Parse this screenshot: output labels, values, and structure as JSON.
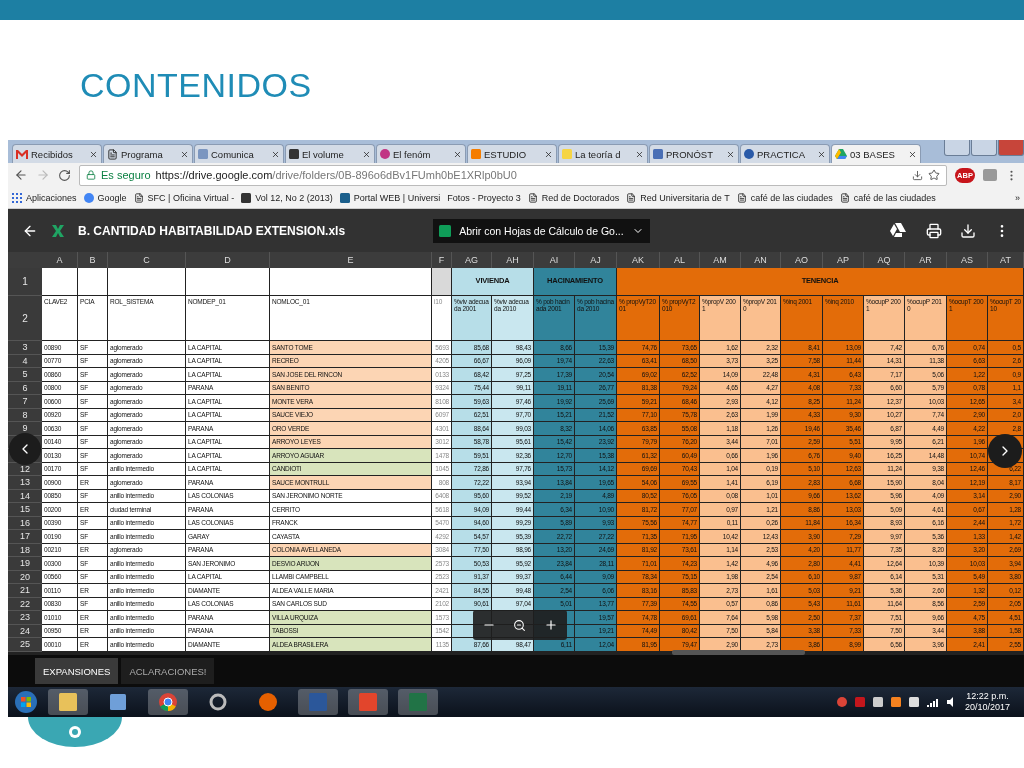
{
  "slide": {
    "title": "CONTENIDOS"
  },
  "browser": {
    "tabs": [
      {
        "label": "Recibidos",
        "selected": false
      },
      {
        "label": "Programa",
        "selected": false
      },
      {
        "label": "Comunica",
        "selected": false
      },
      {
        "label": "El volume",
        "selected": false
      },
      {
        "label": "El fenóm",
        "selected": false
      },
      {
        "label": "ESTUDIO",
        "selected": false
      },
      {
        "label": "La teoría d",
        "selected": false
      },
      {
        "label": "PRONÓST",
        "selected": false
      },
      {
        "label": "PRACTICA",
        "selected": false
      },
      {
        "label": "03 BASES",
        "selected": true
      }
    ],
    "secure_label": "Es seguro",
    "url_host": "https://drive.google.com",
    "url_path": "/drive/folders/0B-896o6dBv1FUmh0bE1XRlp0bU0",
    "extension_badge": "ABP",
    "bookmarks": [
      "Aplicaciones",
      "Google",
      "SFC | Oficina Virtual -",
      "Vol 12, No 2 (2013)",
      "Portal WEB | Universi",
      "Fotos - Proyecto 3",
      "Red de Doctorados",
      "Red Universitaria de T",
      "café de las ciudades",
      "café de las ciudades"
    ],
    "bookmarks_more": "»"
  },
  "viewer": {
    "file_name": "B. CANTIDAD HABITABILIDAD EXTENSION.xls",
    "open_with": "Abrir con Hojas de Cálculo de Go..."
  },
  "sheet": {
    "header_row_numbers": [
      "1",
      "2"
    ],
    "plain_columns": [
      {
        "letter": "A",
        "heading": "CLAVE2"
      },
      {
        "letter": "B",
        "heading": "PCIA"
      },
      {
        "letter": "C",
        "heading": "ROL_SISTEMA"
      },
      {
        "letter": "D",
        "heading": "NOMDEP_01"
      },
      {
        "letter": "E",
        "heading": "NOMLOC_01"
      },
      {
        "letter": "F",
        "heading": "i10"
      }
    ],
    "groups": [
      {
        "label": "VIVIENDA",
        "color": "#b7dee8",
        "columns": [
          {
            "letter": "AG",
            "heading": "%viv adecuada 2001",
            "color": "#b7dee8"
          },
          {
            "letter": "AH",
            "heading": "%viv adecuada 2010",
            "color": "#c9e7ef"
          }
        ]
      },
      {
        "label": "HACINAMIENTO",
        "color": "#31849b",
        "columns": [
          {
            "letter": "AI",
            "heading": "% pob hacinada 2001",
            "color": "#31849b"
          },
          {
            "letter": "AJ",
            "heading": "% pob hacinada 2010",
            "color": "#31849b"
          }
        ]
      },
      {
        "label": "TENENCIA",
        "color": "#e36c09",
        "columns": [
          {
            "letter": "AK",
            "heading": "% propVyT2001",
            "color": "#e36c09"
          },
          {
            "letter": "AL",
            "heading": "% propVyT2010",
            "color": "#e36c09"
          },
          {
            "letter": "AM",
            "heading": "%propV 2001",
            "color": "#fabf8f"
          },
          {
            "letter": "AN",
            "heading": "%propV 2010",
            "color": "#fabf8f"
          },
          {
            "letter": "AO",
            "heading": "%inq 2001",
            "color": "#e36c09"
          },
          {
            "letter": "AP",
            "heading": "%inq 2010",
            "color": "#e36c09"
          },
          {
            "letter": "AQ",
            "heading": "%ocupP 2001",
            "color": "#fabf8f"
          },
          {
            "letter": "AR",
            "heading": "%ocupP 2010",
            "color": "#fabf8f"
          },
          {
            "letter": "AS",
            "heading": "%ocupT 2001",
            "color": "#e36c09"
          },
          {
            "letter": "AT",
            "heading": "%ocupT 2010",
            "color": "#e36c09"
          }
        ]
      }
    ],
    "rows": [
      {
        "number": "3",
        "cells": [
          "00890",
          "SF",
          "aglomerado",
          "LA CAPITAL",
          "SANTO TOME",
          "5693"
        ],
        "color": "#fcd5b4",
        "values": [
          "85,68",
          "98,43",
          "8,66",
          "15,39",
          "74,76",
          "73,65",
          "1,62",
          "2,32",
          "8,41",
          "13,09",
          "7,42",
          "6,76",
          "0,74",
          "0,5"
        ]
      },
      {
        "number": "4",
        "cells": [
          "00770",
          "SF",
          "aglomerado",
          "LA CAPITAL",
          "RECREO",
          "4205"
        ],
        "color": "#fcd5b4",
        "values": [
          "66,67",
          "96,09",
          "19,74",
          "22,63",
          "63,41",
          "68,50",
          "3,73",
          "3,25",
          "7,58",
          "11,44",
          "14,31",
          "11,38",
          "6,63",
          "2,6"
        ]
      },
      {
        "number": "5",
        "cells": [
          "00860",
          "SF",
          "aglomerado",
          "LA CAPITAL",
          "SAN JOSE DEL RINCON",
          "0133"
        ],
        "color": "#fcd5b4",
        "values": [
          "68,42",
          "97,25",
          "17,39",
          "20,54",
          "69,02",
          "62,52",
          "14,09",
          "22,48",
          "4,31",
          "6,43",
          "7,17",
          "5,06",
          "1,22",
          "0,9"
        ]
      },
      {
        "number": "6",
        "cells": [
          "00800",
          "SF",
          "aglomerado",
          "PARANA",
          "SAN BENITO",
          "9324"
        ],
        "color": "#fcd5b4",
        "values": [
          "75,44",
          "99,11",
          "19,11",
          "26,77",
          "81,38",
          "79,24",
          "4,65",
          "4,27",
          "4,08",
          "7,33",
          "6,60",
          "5,79",
          "0,78",
          "1,1"
        ]
      },
      {
        "number": "7",
        "cells": [
          "00600",
          "SF",
          "aglomerado",
          "LA CAPITAL",
          "MONTE VERA",
          "8108"
        ],
        "color": "#fcd5b4",
        "values": [
          "59,63",
          "97,46",
          "19,92",
          "25,69",
          "59,21",
          "68,46",
          "2,93",
          "4,12",
          "8,25",
          "11,24",
          "12,37",
          "10,03",
          "12,65",
          "3,4"
        ]
      },
      {
        "number": "8",
        "cells": [
          "00920",
          "SF",
          "aglomerado",
          "LA CAPITAL",
          "SAUCE VIEJO",
          "6097"
        ],
        "color": "#fcd5b4",
        "values": [
          "62,51",
          "97,70",
          "15,21",
          "21,52",
          "77,10",
          "75,78",
          "2,63",
          "1,99",
          "4,33",
          "9,30",
          "10,27",
          "7,74",
          "2,90",
          "2,0"
        ]
      },
      {
        "number": "9",
        "cells": [
          "00630",
          "SF",
          "aglomerado",
          "PARANA",
          "ORO VERDE",
          "4301"
        ],
        "color": "#fcd5b4",
        "values": [
          "88,64",
          "99,03",
          "8,32",
          "14,06",
          "63,85",
          "55,08",
          "1,18",
          "1,26",
          "19,46",
          "35,46",
          "6,87",
          "4,49",
          "4,22",
          "2,8"
        ]
      },
      {
        "cells": [
          "00140",
          "SF",
          "aglomerado",
          "LA CAPITAL",
          "ARROYO LEYES",
          "3012"
        ],
        "color": "#fcd5b4",
        "covered": false,
        "values": [
          "58,78",
          "95,61",
          "15,42",
          "23,92",
          "79,79",
          "76,20",
          "3,44",
          "7,01",
          "2,59",
          "5,51",
          "9,95",
          "6,21",
          "1,96"
        ]
      },
      {
        "cells": [
          "00130",
          "SF",
          "aglomerado",
          "LA CAPITAL",
          "ARROYO AGUIAR",
          "1478"
        ],
        "color": "#d8e4bc",
        "covered": false,
        "values": [
          "59,51",
          "92,36",
          "12,70",
          "15,38",
          "61,32",
          "60,49",
          "0,66",
          "1,96",
          "6,76",
          "9,40",
          "16,25",
          "14,48",
          "10,74"
        ]
      },
      {
        "number": "12",
        "cells": [
          "00170",
          "SF",
          "anillo intermedio",
          "LA CAPITAL",
          "CANDIOTI",
          "1045"
        ],
        "color": "#d8e4bc",
        "values": [
          "72,86",
          "97,76",
          "15,73",
          "14,12",
          "69,69",
          "70,43",
          "1,04",
          "0,19",
          "5,10",
          "12,63",
          "11,24",
          "9,38",
          "12,46",
          "6,22"
        ]
      },
      {
        "number": "13",
        "cells": [
          "00900",
          "ER",
          "aglomerado",
          "PARANA",
          "SAUCE MONTRULL",
          "808"
        ],
        "color": "#fcd5b4",
        "values": [
          "72,22",
          "93,94",
          "13,84",
          "19,65",
          "54,06",
          "69,55",
          "1,41",
          "6,19",
          "2,83",
          "6,68",
          "15,90",
          "8,04",
          "12,19",
          "8,17"
        ]
      },
      {
        "number": "14",
        "cells": [
          "00850",
          "SF",
          "anillo intermedio",
          "LAS COLONIAS",
          "SAN JERONIMO NORTE",
          "6408"
        ],
        "color": "#ffffff",
        "values": [
          "95,60",
          "99,52",
          "2,19",
          "4,89",
          "80,52",
          "76,05",
          "0,08",
          "1,01",
          "9,66",
          "13,62",
          "5,96",
          "4,09",
          "3,14",
          "2,90"
        ]
      },
      {
        "number": "15",
        "cells": [
          "00200",
          "ER",
          "ciudad terminal",
          "PARANA",
          "CERRITO",
          "5618"
        ],
        "color": "#ffffff",
        "values": [
          "94,09",
          "99,44",
          "6,34",
          "10,90",
          "81,72",
          "77,07",
          "0,97",
          "1,21",
          "8,86",
          "13,03",
          "5,09",
          "4,61",
          "0,67",
          "1,28"
        ]
      },
      {
        "number": "16",
        "cells": [
          "00390",
          "SF",
          "anillo intermedio",
          "LAS COLONIAS",
          "FRANCK",
          "5470"
        ],
        "color": "#ffffff",
        "values": [
          "94,60",
          "99,29",
          "5,89",
          "9,93",
          "75,56",
          "74,77",
          "0,11",
          "0,26",
          "11,84",
          "16,34",
          "8,93",
          "6,16",
          "2,44",
          "1,72"
        ]
      },
      {
        "number": "17",
        "cells": [
          "00190",
          "SF",
          "anillo intermedio",
          "GARAY",
          "CAYASTA",
          "4292"
        ],
        "color": "#ffffff",
        "values": [
          "54,57",
          "95,39",
          "22,72",
          "27,22",
          "71,35",
          "71,95",
          "10,42",
          "12,43",
          "3,90",
          "7,29",
          "9,97",
          "5,36",
          "1,33",
          "1,42"
        ]
      },
      {
        "number": "18",
        "cells": [
          "00210",
          "ER",
          "aglomerado",
          "PARANA",
          "COLONIA AVELLANEDA",
          "3084"
        ],
        "color": "#fcd5b4",
        "values": [
          "77,50",
          "98,96",
          "13,20",
          "24,69",
          "81,92",
          "73,61",
          "1,14",
          "2,53",
          "4,20",
          "11,77",
          "7,35",
          "8,20",
          "3,20",
          "2,69"
        ]
      },
      {
        "number": "19",
        "cells": [
          "00300",
          "SF",
          "anillo intermedio",
          "SAN JERONIMO",
          "DESVIO ARIJON",
          "2573"
        ],
        "color": "#d8e4bc",
        "values": [
          "50,53",
          "95,92",
          "23,84",
          "28,11",
          "71,01",
          "74,23",
          "1,42",
          "4,96",
          "2,80",
          "4,41",
          "12,64",
          "10,39",
          "10,03",
          "3,94"
        ]
      },
      {
        "number": "20",
        "cells": [
          "00560",
          "SF",
          "anillo intermedio",
          "LA CAPITAL",
          "LLAMBI CAMPBELL",
          "2523"
        ],
        "color": "#ffffff",
        "values": [
          "91,37",
          "99,37",
          "6,44",
          "9,09",
          "78,34",
          "75,15",
          "1,98",
          "2,54",
          "6,10",
          "9,87",
          "6,14",
          "5,31",
          "5,49",
          "3,80"
        ]
      },
      {
        "number": "21",
        "cells": [
          "00110",
          "ER",
          "anillo intermedio",
          "DIAMANTE",
          "ALDEA VALLE MARIA",
          "2421"
        ],
        "color": "#ffffff",
        "values": [
          "84,55",
          "99,48",
          "2,54",
          "6,06",
          "83,16",
          "85,83",
          "2,73",
          "1,61",
          "5,03",
          "9,21",
          "5,36",
          "2,60",
          "1,32",
          "0,12"
        ]
      },
      {
        "number": "22",
        "cells": [
          "00830",
          "SF",
          "anillo intermedio",
          "LAS COLONIAS",
          "SAN CARLOS SUD",
          "2102"
        ],
        "color": "#ffffff",
        "values": [
          "90,61",
          "97,04",
          "5,01",
          "13,77",
          "77,39",
          "74,55",
          "0,57",
          "0,86",
          "5,43",
          "11,61",
          "11,64",
          "8,56",
          "2,59",
          "2,05"
        ]
      },
      {
        "number": "23",
        "cells": [
          "01010",
          "ER",
          "anillo intermedio",
          "PARANA",
          "VILLA URQUIZA",
          "1573"
        ],
        "color": "#d8e4bc",
        "covered": true,
        "values": [
          "19,57",
          "74,78",
          "69,61",
          "7,64",
          "5,98",
          "2,50",
          "7,37",
          "7,51",
          "9,66",
          "4,75",
          "4,51"
        ]
      },
      {
        "number": "24",
        "cells": [
          "00950",
          "ER",
          "anillo intermedio",
          "PARANA",
          "TABOSSI",
          "1542"
        ],
        "color": "#d8e4bc",
        "covered": true,
        "values": [
          "19,21",
          "74,49",
          "80,42",
          "7,50",
          "5,84",
          "3,38",
          "7,33",
          "7,50",
          "3,44",
          "3,88",
          "1,58"
        ]
      },
      {
        "number": "25",
        "cells": [
          "00010",
          "ER",
          "anillo intermedio",
          "DIAMANTE",
          "ALDEA BRASILERA",
          "1135"
        ],
        "color": "#d8e4bc",
        "values": [
          "87,66",
          "98,47",
          "6,11",
          "12,04",
          "81,95",
          "79,47",
          "2,90",
          "2,73",
          "3,86",
          "8,99",
          "6,56",
          "3,96",
          "2,41",
          "2,55"
        ]
      }
    ],
    "sheet_tabs": [
      {
        "label": "EXPANSIONES",
        "selected": true
      },
      {
        "label": "ACLARACIONES!",
        "selected": false
      }
    ]
  },
  "taskbar": {
    "time": "12:22 p.m.",
    "date": "20/10/2017"
  }
}
